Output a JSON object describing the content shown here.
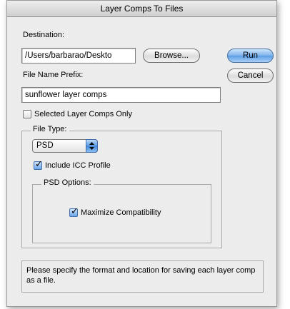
{
  "window": {
    "title": "Layer Comps To Files"
  },
  "destination": {
    "label": "Destination:",
    "value": "/Users/barbarao/Deskto",
    "browse_label": "Browse..."
  },
  "file_name_prefix": {
    "label": "File Name Prefix:",
    "value": "sunflower layer comps"
  },
  "buttons": {
    "run": "Run",
    "cancel": "Cancel"
  },
  "selected_only": {
    "label": "Selected Layer Comps Only",
    "checked": false
  },
  "file_type": {
    "legend": "File Type:",
    "selected": "PSD",
    "include_icc": {
      "label": "Include ICC Profile",
      "checked": true
    }
  },
  "psd_options": {
    "legend": "PSD Options:",
    "maximize_compat": {
      "label": "Maximize Compatibility",
      "checked": true
    }
  },
  "hint": "Please specify the format and location for saving each layer comp as a file.",
  "colors": {
    "accent": "#5a9ce6",
    "dialog_bg": "#ececec"
  },
  "icons": {
    "check": "check-icon",
    "select_arrows": "up-down-arrows-icon"
  }
}
